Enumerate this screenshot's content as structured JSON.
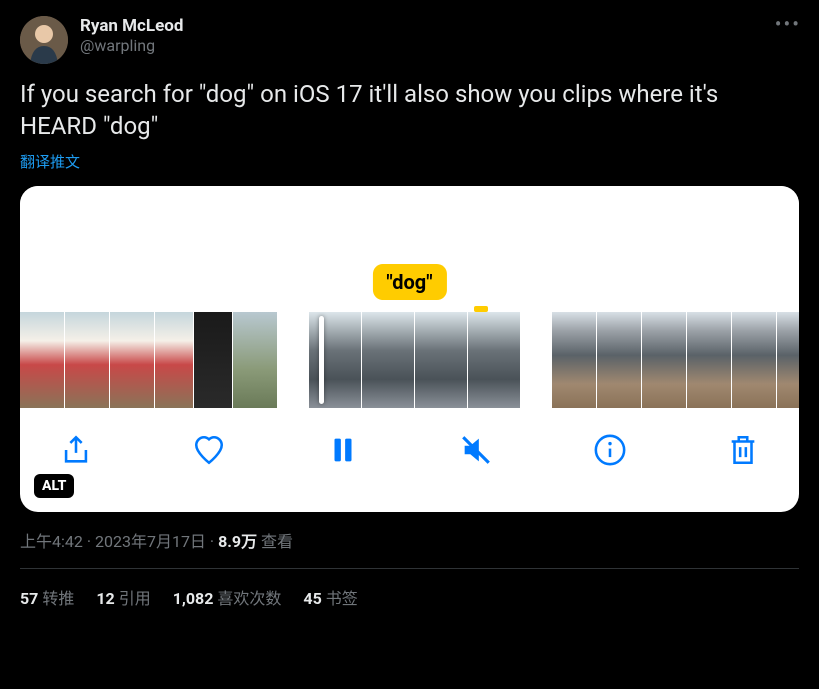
{
  "user": {
    "display_name": "Ryan McLeod",
    "handle": "@warpling"
  },
  "tweet": {
    "text": "If you search for \"dog\" on iOS 17 it'll also show you clips where it's HEARD \"dog\"",
    "translate_label": "翻译推文"
  },
  "media": {
    "tag_text": "\"dog\"",
    "alt_badge": "ALT"
  },
  "meta": {
    "time": "上午4:42",
    "date": "2023年7月17日",
    "views_count": "8.9万",
    "views_label": "查看",
    "separator": " · "
  },
  "stats": {
    "retweets": {
      "count": "57",
      "label": "转推"
    },
    "quotes": {
      "count": "12",
      "label": "引用"
    },
    "likes": {
      "count": "1,082",
      "label": "喜欢次数"
    },
    "bookmarks": {
      "count": "45",
      "label": "书签"
    }
  }
}
